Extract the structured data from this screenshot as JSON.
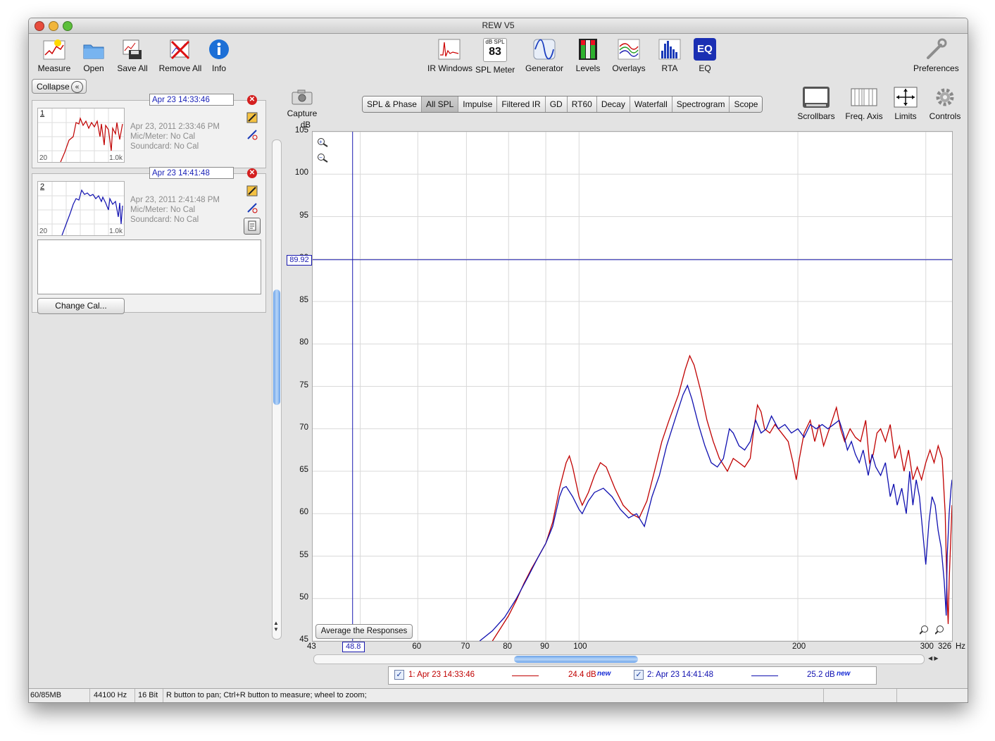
{
  "window": {
    "title": "REW V5"
  },
  "toolbar": {
    "measure": "Measure",
    "open": "Open",
    "save_all": "Save All",
    "remove_all": "Remove All",
    "info": "Info",
    "ir_windows": "IR Windows",
    "spl_meter": "SPL Meter",
    "spl_meter_icon_unit": "dB SPL",
    "spl_meter_icon_value": "83",
    "generator": "Generator",
    "levels": "Levels",
    "overlays": "Overlays",
    "rta": "RTA",
    "eq": "EQ",
    "eq_icon_text": "EQ",
    "preferences": "Preferences"
  },
  "left_panel": {
    "collapse": "Collapse",
    "measurements": [
      {
        "num": "1",
        "datetime_field": "Apr 23 14:33:46",
        "date": "Apr 23, 2011 2:33:46 PM",
        "mic": "Mic/Meter: No Cal",
        "soundcard": "Soundcard: No Cal",
        "thumb_min": "20",
        "thumb_max": "1.0k",
        "color": "#c00000"
      },
      {
        "num": "2",
        "datetime_field": "Apr 23 14:41:48",
        "date": "Apr 23, 2011 2:41:48 PM",
        "mic": "Mic/Meter: No Cal",
        "soundcard": "Soundcard: No Cal",
        "thumb_min": "20",
        "thumb_max": "1.0k",
        "color": "#1010b0"
      }
    ],
    "change_cal": "Change Cal..."
  },
  "graph_toolbar": {
    "capture": "Capture",
    "tabs": [
      "SPL & Phase",
      "All SPL",
      "Impulse",
      "Filtered IR",
      "GD",
      "RT60",
      "Decay",
      "Waterfall",
      "Spectrogram",
      "Scope"
    ],
    "active_tab": "All SPL",
    "scrollbars": "Scrollbars",
    "freq_axis": "Freq. Axis",
    "limits": "Limits",
    "controls": "Controls"
  },
  "chart_data": {
    "type": "line",
    "ylabel": "dB",
    "xlabel_unit": "Hz",
    "x_scale": "log",
    "xlim": [
      43,
      326
    ],
    "ylim": [
      45,
      105
    ],
    "y_ticks": [
      "105",
      "100",
      "95",
      "90",
      "85",
      "80",
      "75",
      "70",
      "65",
      "60",
      "55",
      "50",
      "45"
    ],
    "x_ticks": [
      "43",
      "60",
      "70",
      "80",
      "90",
      "100",
      "200",
      "300",
      "326"
    ],
    "cursor": {
      "x": "48.8",
      "y": "89.92"
    },
    "grid": true,
    "series": [
      {
        "name": "1: Apr 23 14:33:46",
        "color": "#c00000",
        "points": [
          [
            76,
            45
          ],
          [
            78,
            46.5
          ],
          [
            80,
            48
          ],
          [
            82,
            49.8
          ],
          [
            84,
            51.8
          ],
          [
            86,
            53.5
          ],
          [
            88,
            55
          ],
          [
            90,
            56.5
          ],
          [
            92,
            59
          ],
          [
            94,
            63
          ],
          [
            96,
            66
          ],
          [
            97,
            66.8
          ],
          [
            98,
            65.5
          ],
          [
            100,
            62
          ],
          [
            101,
            61
          ],
          [
            103,
            62.5
          ],
          [
            105,
            64.5
          ],
          [
            107,
            66
          ],
          [
            109,
            65.5
          ],
          [
            112,
            63
          ],
          [
            115,
            61
          ],
          [
            118,
            60
          ],
          [
            121,
            59.5
          ],
          [
            124,
            61.5
          ],
          [
            127,
            65
          ],
          [
            130,
            68.5
          ],
          [
            133,
            71
          ],
          [
            137,
            74
          ],
          [
            140,
            77
          ],
          [
            142,
            78.6
          ],
          [
            144,
            77.5
          ],
          [
            147,
            74.5
          ],
          [
            150,
            71
          ],
          [
            153,
            68.5
          ],
          [
            156,
            66.5
          ],
          [
            160,
            65
          ],
          [
            163,
            66.5
          ],
          [
            166,
            66
          ],
          [
            169,
            65.5
          ],
          [
            172,
            66.5
          ],
          [
            174,
            70
          ],
          [
            176,
            72.8
          ],
          [
            178,
            72
          ],
          [
            180,
            70
          ],
          [
            183,
            69.5
          ],
          [
            186,
            70.5
          ],
          [
            190,
            69.5
          ],
          [
            194,
            68.5
          ],
          [
            197,
            66
          ],
          [
            199,
            64
          ],
          [
            201,
            66.5
          ],
          [
            204,
            69.5
          ],
          [
            208,
            71
          ],
          [
            211,
            68.5
          ],
          [
            214,
            70.5
          ],
          [
            217,
            68
          ],
          [
            220,
            69.5
          ],
          [
            223,
            71
          ],
          [
            226,
            72.5
          ],
          [
            229,
            70
          ],
          [
            232,
            68.5
          ],
          [
            236,
            70
          ],
          [
            240,
            69
          ],
          [
            244,
            68.5
          ],
          [
            248,
            71
          ],
          [
            251,
            66
          ],
          [
            254,
            67
          ],
          [
            257,
            69.5
          ],
          [
            260,
            70
          ],
          [
            264,
            68.5
          ],
          [
            268,
            70.5
          ],
          [
            272,
            66.5
          ],
          [
            276,
            68
          ],
          [
            280,
            65
          ],
          [
            284,
            67.5
          ],
          [
            288,
            64
          ],
          [
            292,
            65.5
          ],
          [
            296,
            64
          ],
          [
            300,
            66
          ],
          [
            304,
            67.5
          ],
          [
            308,
            66
          ],
          [
            312,
            68
          ],
          [
            316,
            66.5
          ],
          [
            319,
            60
          ],
          [
            321,
            50
          ],
          [
            322,
            47
          ],
          [
            323,
            52
          ],
          [
            325,
            58
          ],
          [
            326,
            61
          ]
        ]
      },
      {
        "name": "2: Apr 23 14:41:48",
        "color": "#1010b0",
        "points": [
          [
            73,
            45
          ],
          [
            76,
            46.2
          ],
          [
            79,
            47.8
          ],
          [
            82,
            50
          ],
          [
            85,
            52.5
          ],
          [
            88,
            55
          ],
          [
            90,
            56.5
          ],
          [
            92,
            58.5
          ],
          [
            94,
            62
          ],
          [
            95,
            63
          ],
          [
            96,
            63.2
          ],
          [
            98,
            62
          ],
          [
            100,
            60.5
          ],
          [
            101,
            60
          ],
          [
            103,
            61.5
          ],
          [
            105,
            62.5
          ],
          [
            108,
            63
          ],
          [
            111,
            62
          ],
          [
            114,
            60.5
          ],
          [
            117,
            59.5
          ],
          [
            120,
            60
          ],
          [
            123,
            58.5
          ],
          [
            126,
            62
          ],
          [
            129,
            64.5
          ],
          [
            132,
            68
          ],
          [
            136,
            71.5
          ],
          [
            139,
            74
          ],
          [
            141,
            75.1
          ],
          [
            143,
            73.5
          ],
          [
            146,
            70.5
          ],
          [
            149,
            68
          ],
          [
            152,
            66
          ],
          [
            155,
            65.5
          ],
          [
            158,
            66.5
          ],
          [
            161,
            70
          ],
          [
            163,
            69.5
          ],
          [
            166,
            68
          ],
          [
            169,
            67.5
          ],
          [
            172,
            68.5
          ],
          [
            175,
            71
          ],
          [
            178,
            69.5
          ],
          [
            181,
            70
          ],
          [
            184,
            71.5
          ],
          [
            188,
            70
          ],
          [
            192,
            70.5
          ],
          [
            196,
            69.5
          ],
          [
            200,
            70
          ],
          [
            204,
            69
          ],
          [
            208,
            70.5
          ],
          [
            212,
            70
          ],
          [
            216,
            70.5
          ],
          [
            220,
            70
          ],
          [
            224,
            70.5
          ],
          [
            228,
            71
          ],
          [
            231,
            69.5
          ],
          [
            234,
            67.5
          ],
          [
            237,
            68.5
          ],
          [
            240,
            67
          ],
          [
            243,
            66
          ],
          [
            246,
            67.5
          ],
          [
            250,
            64.5
          ],
          [
            253,
            67
          ],
          [
            256,
            65.5
          ],
          [
            260,
            64.5
          ],
          [
            264,
            66
          ],
          [
            268,
            62
          ],
          [
            271,
            63.5
          ],
          [
            274,
            61
          ],
          [
            278,
            63
          ],
          [
            282,
            60
          ],
          [
            285,
            65
          ],
          [
            288,
            61
          ],
          [
            291,
            64
          ],
          [
            294,
            62
          ],
          [
            297,
            58
          ],
          [
            300,
            54
          ],
          [
            303,
            59
          ],
          [
            306,
            62
          ],
          [
            309,
            61
          ],
          [
            312,
            58
          ],
          [
            315,
            56
          ],
          [
            318,
            52
          ],
          [
            320,
            48
          ],
          [
            321,
            55
          ],
          [
            323,
            60
          ],
          [
            325,
            63
          ],
          [
            326,
            64
          ]
        ]
      }
    ],
    "legend": [
      {
        "label": "1: Apr 23 14:33:46",
        "value": "24.4 dB",
        "tag": "new"
      },
      {
        "label": "2: Apr 23 14:41:48",
        "value": "25.2 dB",
        "tag": "new"
      }
    ],
    "average_button": "Average the Responses"
  },
  "status_bar": {
    "memory": "60/85MB",
    "sample_rate": "44100 Hz",
    "bits": "16 Bit",
    "hint": "R button to pan; Ctrl+R button to measure; wheel to zoom;"
  }
}
